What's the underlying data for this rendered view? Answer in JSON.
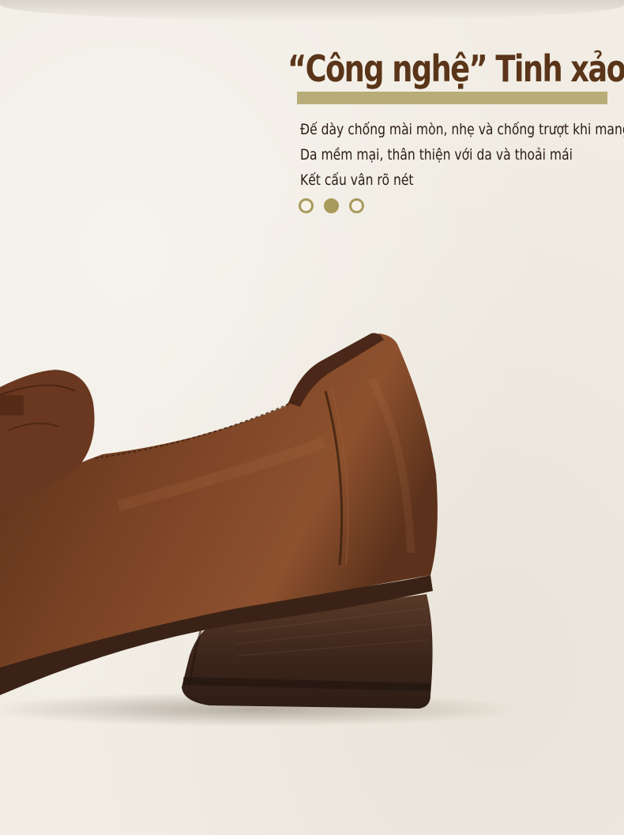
{
  "section": {
    "title": "“Công nghệ” Tinh xảo",
    "features": [
      "Đế dày chống mài mòn, nhẹ và chống trượt khi mang",
      "Da mềm mại, thân thiện với da và thoải mái",
      "Kết cấu vân rõ nét"
    ]
  },
  "carousel": {
    "dot_count": 3,
    "active_index": 1
  },
  "colors": {
    "background": "#f1ede4",
    "title": "#5a3519",
    "underline": "#b8ad78",
    "text": "#2a1c13",
    "leather": "#6e3b1f",
    "heel": "#4a2f22",
    "dot_accent": "#a79a5c"
  },
  "image": {
    "subject": "brown-leather-shoe-heel-closeup"
  }
}
